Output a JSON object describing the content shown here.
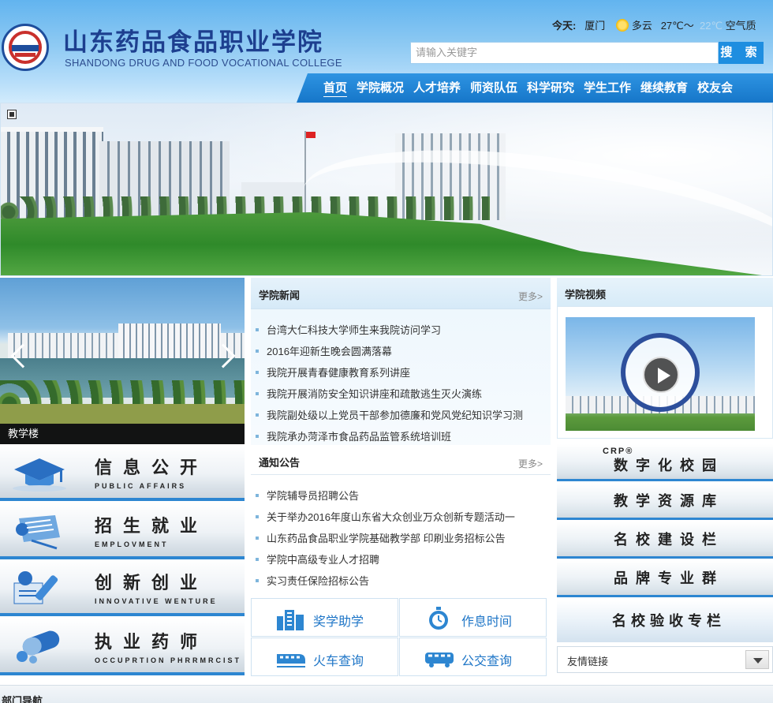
{
  "header": {
    "logo_cn": "山东药品食品职业学院",
    "logo_en": "SHANDONG DRUG AND FOOD VOCATIONAL COLLEGE",
    "weather": {
      "today_label": "今天:",
      "city": "厦门",
      "condition": "多云",
      "temp_high": "27℃～",
      "temp_low": "22℃",
      "air_label": "空气质"
    },
    "search": {
      "placeholder": "请输入关键字",
      "button": "搜 索"
    },
    "nav": [
      "首页",
      "学院概况",
      "人才培养",
      "师资队伍",
      "科学研究",
      "学生工作",
      "继续教育",
      "校友会"
    ]
  },
  "slider": {
    "caption": "教学楼"
  },
  "quick_links": [
    {
      "cn": "信息公开",
      "en": "PUBLIC AFFAIRS",
      "icon": "graduation-cap-icon"
    },
    {
      "cn": "招生就业",
      "en": "EMPLOVMENT",
      "icon": "diploma-scroll-icon"
    },
    {
      "cn": "创新创业",
      "en": "INNOVATIVE WENTURE",
      "icon": "pen-document-icon"
    },
    {
      "cn": "执业药师",
      "en": "OCCUPRTION PHRRMRCIST",
      "icon": "capsule-icon"
    }
  ],
  "news": {
    "title": "学院新闻",
    "more": "更多>",
    "items": [
      "台湾大仁科技大学师生来我院访问学习",
      "2016年迎新生晚会圆满落幕",
      "我院开展青春健康教育系列讲座",
      "我院开展消防安全知识讲座和疏散逃生灭火演练",
      "我院副处级以上党员干部参加德廉和党风党纪知识学习测",
      "我院承办菏泽市食品药品监管系统培训班"
    ]
  },
  "notices": {
    "title": "通知公告",
    "more": "更多>",
    "items": [
      "学院辅导员招聘公告",
      "关于举办2016年度山东省大众创业万众创新专题活动一",
      "山东药品食品职业学院基础教学部 印刷业务招标公告",
      "学院中高级专业人才招聘",
      "实习责任保险招标公告"
    ]
  },
  "services": [
    {
      "label": "奖学助学",
      "icon": "building-icon"
    },
    {
      "label": "作息时间",
      "icon": "stopwatch-icon"
    },
    {
      "label": "火车查询",
      "icon": "train-icon"
    },
    {
      "label": "公交查询",
      "icon": "bus-icon"
    }
  ],
  "video": {
    "title": "学院视频"
  },
  "right_buttons": {
    "crp": "CRP®",
    "items": [
      "数字化校园",
      "教学资源库",
      "名校建设栏",
      "品牌专业群",
      "名校验收专栏"
    ]
  },
  "friend_links": {
    "label": "友情链接"
  },
  "dept_nav": {
    "title": "部门导航"
  },
  "colors": {
    "accent": "#1e8ee0",
    "nav_bg": "#1676c9",
    "link_blue": "#1f76c7",
    "brand_navy": "#1d3f8f"
  }
}
